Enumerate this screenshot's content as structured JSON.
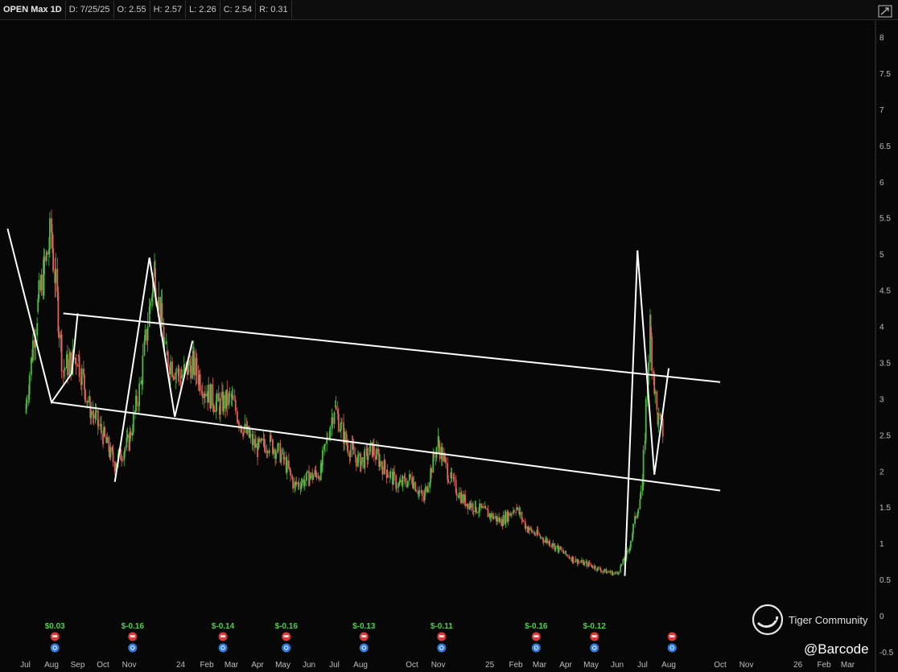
{
  "header": {
    "symbol": "OPEN Max 1D",
    "date": "D: 7/25/25",
    "open": "O: 2.55",
    "high": "H: 2.57",
    "low": "L: 2.26",
    "close": "C: 2.54",
    "range": "R: 0.31"
  },
  "watermarks": {
    "community": "Tiger Community",
    "handle": "@Barcode"
  },
  "colors": {
    "background": "#070707",
    "up": "#4cbb3e",
    "down": "#d9655a",
    "drawing": "#ffffff",
    "earnings_text": "#4fcf4f",
    "earnings_badge": "#d63b3b",
    "dividend_badge": "#2f7de0"
  },
  "chart_data": {
    "type": "line",
    "title": "",
    "xlabel": "",
    "ylabel": "",
    "ylim": [
      0.5,
      8
    ],
    "y_ticks": [
      "8",
      "7.5",
      "7",
      "6.5",
      "6",
      "5.5",
      "5",
      "4.5",
      "4",
      "3.5",
      "3",
      "2.5",
      "2",
      "1.5",
      "1",
      "0.5",
      "0",
      "-0.5"
    ],
    "x_ticks": [
      "Jul",
      "Aug",
      "Sep",
      "Oct",
      "Nov",
      "24",
      "Feb",
      "Mar",
      "Apr",
      "May",
      "Jun",
      "Jul",
      "Aug",
      "Oct",
      "Nov",
      "25",
      "Feb",
      "Mar",
      "Apr",
      "May",
      "Jun",
      "Jul",
      "Aug",
      "Oct",
      "Nov",
      "26",
      "Feb",
      "Mar"
    ],
    "grid": false,
    "series": [
      {
        "name": "",
        "x": [
          "2023-07-01",
          "2023-07-15",
          "2023-08-01",
          "2023-08-15",
          "2023-09-01",
          "2023-09-15",
          "2023-10-01",
          "2023-10-15",
          "2023-11-01",
          "2023-11-15",
          "2023-12-01",
          "2023-12-15",
          "2024-01-01",
          "2024-01-15",
          "2024-02-01",
          "2024-02-15",
          "2024-03-01",
          "2024-03-15",
          "2024-04-01",
          "2024-04-15",
          "2024-05-01",
          "2024-05-15",
          "2024-06-01",
          "2024-06-15",
          "2024-07-01",
          "2024-07-15",
          "2024-08-01",
          "2024-08-15",
          "2024-09-01",
          "2024-09-15",
          "2024-10-01",
          "2024-10-15",
          "2024-11-01",
          "2024-11-15",
          "2024-12-01",
          "2024-12-15",
          "2025-01-01",
          "2025-01-15",
          "2025-02-01",
          "2025-02-15",
          "2025-03-01",
          "2025-03-15",
          "2025-04-01",
          "2025-04-15",
          "2025-05-01",
          "2025-05-15",
          "2025-06-01",
          "2025-06-15",
          "2025-07-01",
          "2025-07-10",
          "2025-07-18",
          "2025-07-25"
        ],
        "values": [
          2.8,
          4.2,
          5.3,
          3.4,
          3.6,
          2.9,
          2.5,
          2.1,
          2.4,
          3.2,
          4.8,
          3.6,
          3.3,
          3.5,
          3.1,
          2.9,
          3.0,
          2.6,
          2.3,
          2.4,
          2.2,
          1.8,
          1.9,
          2.0,
          2.9,
          2.4,
          2.1,
          2.3,
          2.0,
          1.8,
          1.9,
          1.6,
          2.4,
          1.9,
          1.6,
          1.5,
          1.4,
          1.3,
          1.5,
          1.2,
          1.1,
          1.0,
          0.85,
          0.75,
          0.7,
          0.62,
          0.58,
          0.9,
          1.8,
          4.0,
          2.8,
          2.54
        ]
      }
    ],
    "annotations": [
      {
        "kind": "trendline",
        "from": [
          "2023-08-01",
          2.95
        ],
        "to": [
          "2025-10-01",
          1.73
        ]
      },
      {
        "kind": "trendline",
        "from": [
          "2023-08-15",
          4.18
        ],
        "to": [
          "2025-10-01",
          3.23
        ]
      },
      {
        "kind": "zigzag",
        "points": [
          [
            "2023-06-10",
            5.35
          ],
          [
            "2023-08-01",
            2.95
          ],
          [
            "2023-08-25",
            3.35
          ],
          [
            "2023-09-01",
            4.18
          ]
        ]
      },
      {
        "kind": "zigzag",
        "points": [
          [
            "2023-10-15",
            1.85
          ],
          [
            "2023-11-25",
            4.95
          ],
          [
            "2023-12-25",
            2.75
          ],
          [
            "2024-01-15",
            3.8
          ]
        ]
      },
      {
        "kind": "zigzag",
        "points": [
          [
            "2025-06-10",
            0.55
          ],
          [
            "2025-06-25",
            5.05
          ],
          [
            "2025-07-15",
            1.95
          ],
          [
            "2025-08-01",
            3.42
          ]
        ]
      }
    ],
    "earnings": [
      {
        "date": "2023-08-05",
        "label": "$0.03"
      },
      {
        "date": "2023-11-05",
        "label": "$-0.16"
      },
      {
        "date": "2024-02-20",
        "label": "$-0.14"
      },
      {
        "date": "2024-05-05",
        "label": "$-0.16"
      },
      {
        "date": "2024-08-05",
        "label": "$-0.13"
      },
      {
        "date": "2024-11-05",
        "label": "$-0.11"
      },
      {
        "date": "2025-02-25",
        "label": "$-0.16"
      },
      {
        "date": "2025-05-05",
        "label": "$-0.12"
      },
      {
        "date": "2025-08-05",
        "label": ""
      }
    ]
  }
}
